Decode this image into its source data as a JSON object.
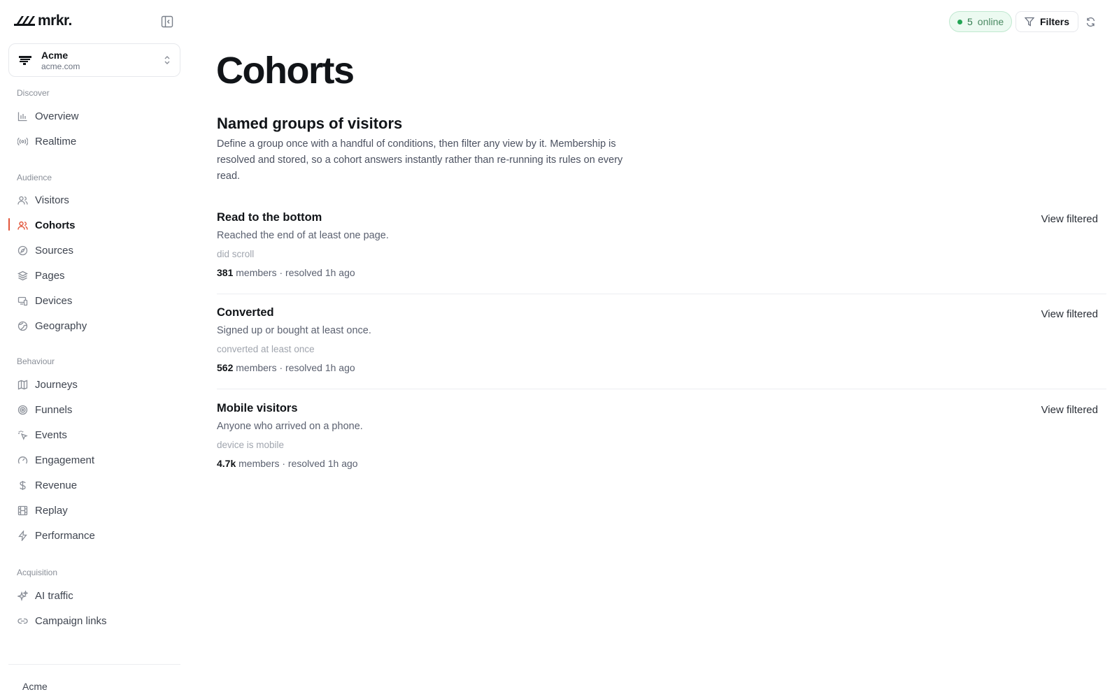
{
  "brand": {
    "name": "mrkr."
  },
  "workspace": {
    "name": "Acme",
    "domain": "acme.com"
  },
  "nav": {
    "sections": [
      {
        "title": "Discover",
        "items": [
          {
            "label": "Overview",
            "icon": "bar-chart-icon"
          },
          {
            "label": "Realtime",
            "icon": "broadcast-icon"
          }
        ]
      },
      {
        "title": "Audience",
        "items": [
          {
            "label": "Visitors",
            "icon": "users-icon"
          },
          {
            "label": "Cohorts",
            "icon": "user-group-icon",
            "active": true
          },
          {
            "label": "Sources",
            "icon": "compass-icon"
          },
          {
            "label": "Pages",
            "icon": "layers-icon"
          },
          {
            "label": "Devices",
            "icon": "devices-icon"
          },
          {
            "label": "Geography",
            "icon": "globe-icon"
          }
        ]
      },
      {
        "title": "Behaviour",
        "items": [
          {
            "label": "Journeys",
            "icon": "map-icon"
          },
          {
            "label": "Funnels",
            "icon": "target-icon"
          },
          {
            "label": "Events",
            "icon": "click-icon"
          },
          {
            "label": "Engagement",
            "icon": "gauge-icon"
          },
          {
            "label": "Revenue",
            "icon": "dollar-icon"
          },
          {
            "label": "Replay",
            "icon": "film-icon"
          },
          {
            "label": "Performance",
            "icon": "bolt-icon"
          }
        ]
      },
      {
        "title": "Acquisition",
        "items": [
          {
            "label": "AI traffic",
            "icon": "sparkles-icon"
          },
          {
            "label": "Campaign links",
            "icon": "link-icon"
          }
        ]
      }
    ]
  },
  "footer": {
    "org": "Acme"
  },
  "topbar": {
    "online_count": "5",
    "online_label": "online",
    "filters_label": "Filters"
  },
  "page": {
    "title": "Cohorts",
    "heading": "Named groups of visitors",
    "description": "Define a group once with a handful of conditions, then filter any view by it. Membership is resolved and stored, so a cohort answers instantly rather than re-running its rules on every read."
  },
  "cohorts": [
    {
      "name": "Read to the bottom",
      "description": "Reached the end of at least one page.",
      "rule": "did scroll",
      "members": "381",
      "meta": "members · resolved 1h ago",
      "action": "View filtered"
    },
    {
      "name": "Converted",
      "description": "Signed up or bought at least once.",
      "rule": "converted at least once",
      "members": "562",
      "meta": "members · resolved 1h ago",
      "action": "View filtered"
    },
    {
      "name": "Mobile visitors",
      "description": "Anyone who arrived on a phone.",
      "rule": "device is mobile",
      "members": "4.7k",
      "meta": "members · resolved 1h ago",
      "action": "View filtered"
    }
  ],
  "colors": {
    "accent": "#e2553a",
    "online_green": "#22a554",
    "text": "#111418",
    "muted": "#5b6170"
  }
}
